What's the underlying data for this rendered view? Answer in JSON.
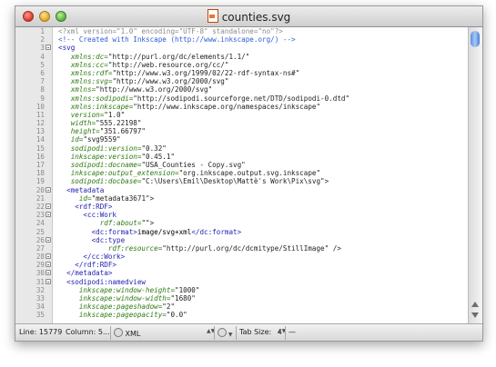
{
  "window": {
    "title": "counties.svg",
    "file_icon": "svg-file-icon"
  },
  "editor": {
    "lines": [
      {
        "n": "1",
        "fold": false,
        "segs": [
          {
            "t": "<?xml version=\"1.0\" encoding=\"UTF-8\" standalone=\"no\"?>",
            "c": "decl"
          }
        ]
      },
      {
        "n": "2",
        "fold": false,
        "segs": [
          {
            "t": "<!-- Created with Inkscape (http://www.inkscape.org/) -->",
            "c": "comment"
          }
        ]
      },
      {
        "n": "3",
        "fold": true,
        "segs": [
          {
            "t": "<svg",
            "c": "tag"
          }
        ]
      },
      {
        "n": "4",
        "fold": false,
        "segs": [
          {
            "t": "   xmlns:dc=",
            "c": "attr"
          },
          {
            "t": "\"http://purl.org/dc/elements/1.1/\"",
            "c": "val"
          }
        ]
      },
      {
        "n": "5",
        "fold": false,
        "segs": [
          {
            "t": "   xmlns:cc=",
            "c": "attr"
          },
          {
            "t": "\"http://web.resource.org/cc/\"",
            "c": "val"
          }
        ]
      },
      {
        "n": "6",
        "fold": false,
        "segs": [
          {
            "t": "   xmlns:rdf=",
            "c": "attr"
          },
          {
            "t": "\"http://www.w3.org/1999/02/22-rdf-syntax-ns#\"",
            "c": "val"
          }
        ]
      },
      {
        "n": "7",
        "fold": false,
        "segs": [
          {
            "t": "   xmlns:svg=",
            "c": "attr"
          },
          {
            "t": "\"http://www.w3.org/2000/svg\"",
            "c": "val"
          }
        ]
      },
      {
        "n": "8",
        "fold": false,
        "segs": [
          {
            "t": "   xmlns=",
            "c": "attr"
          },
          {
            "t": "\"http://www.w3.org/2000/svg\"",
            "c": "val"
          }
        ]
      },
      {
        "n": "9",
        "fold": false,
        "segs": [
          {
            "t": "   xmlns:sodipodi=",
            "c": "attr"
          },
          {
            "t": "\"http://sodipodi.sourceforge.net/DTD/sodipodi-0.dtd\"",
            "c": "val"
          }
        ]
      },
      {
        "n": "10",
        "fold": false,
        "segs": [
          {
            "t": "   xmlns:inkscape=",
            "c": "attr"
          },
          {
            "t": "\"http://www.inkscape.org/namespaces/inkscape\"",
            "c": "val"
          }
        ]
      },
      {
        "n": "11",
        "fold": false,
        "segs": [
          {
            "t": "   version=",
            "c": "attr"
          },
          {
            "t": "\"1.0\"",
            "c": "val"
          }
        ]
      },
      {
        "n": "12",
        "fold": false,
        "segs": [
          {
            "t": "   width=",
            "c": "attr"
          },
          {
            "t": "\"555.22198\"",
            "c": "val"
          }
        ]
      },
      {
        "n": "13",
        "fold": false,
        "segs": [
          {
            "t": "   height=",
            "c": "attr"
          },
          {
            "t": "\"351.66797\"",
            "c": "val"
          }
        ]
      },
      {
        "n": "14",
        "fold": false,
        "segs": [
          {
            "t": "   id=",
            "c": "attr"
          },
          {
            "t": "\"svg9559\"",
            "c": "val"
          }
        ]
      },
      {
        "n": "15",
        "fold": false,
        "segs": [
          {
            "t": "   sodipodi:version=",
            "c": "attr"
          },
          {
            "t": "\"0.32\"",
            "c": "val"
          }
        ]
      },
      {
        "n": "16",
        "fold": false,
        "segs": [
          {
            "t": "   inkscape:version=",
            "c": "attr"
          },
          {
            "t": "\"0.45.1\"",
            "c": "val"
          }
        ]
      },
      {
        "n": "17",
        "fold": false,
        "segs": [
          {
            "t": "   sodipodi:docname=",
            "c": "attr"
          },
          {
            "t": "\"USA_Counties - Copy.svg\"",
            "c": "val"
          }
        ]
      },
      {
        "n": "18",
        "fold": false,
        "segs": [
          {
            "t": "   inkscape:output_extension=",
            "c": "attr"
          },
          {
            "t": "\"org.inkscape.output.svg.inkscape\"",
            "c": "val"
          }
        ]
      },
      {
        "n": "19",
        "fold": false,
        "segs": [
          {
            "t": "   sodipodi:docbase=",
            "c": "attr"
          },
          {
            "t": "\"C:\\Users\\Emil\\Desktop\\Mattè's Work\\Pix\\svg\">",
            "c": "val"
          }
        ]
      },
      {
        "n": "20",
        "fold": true,
        "segs": [
          {
            "t": "  <metadata",
            "c": "tag"
          }
        ]
      },
      {
        "n": "21",
        "fold": false,
        "segs": [
          {
            "t": "     id=",
            "c": "attr"
          },
          {
            "t": "\"metadata3671\">",
            "c": "val"
          }
        ]
      },
      {
        "n": "22",
        "fold": true,
        "segs": [
          {
            "t": "    <rdf:RDF>",
            "c": "tag"
          }
        ]
      },
      {
        "n": "23",
        "fold": true,
        "segs": [
          {
            "t": "      <cc:Work",
            "c": "tag"
          }
        ]
      },
      {
        "n": "24",
        "fold": false,
        "segs": [
          {
            "t": "          rdf:about=",
            "c": "attr"
          },
          {
            "t": "\"\">",
            "c": "val"
          }
        ]
      },
      {
        "n": "25",
        "fold": false,
        "segs": [
          {
            "t": "        <dc:format>",
            "c": "tag"
          },
          {
            "t": "image/svg+xml",
            "c": "text"
          },
          {
            "t": "</dc:format>",
            "c": "tag"
          }
        ]
      },
      {
        "n": "26",
        "fold": true,
        "segs": [
          {
            "t": "        <dc:type",
            "c": "tag"
          }
        ]
      },
      {
        "n": "27",
        "fold": false,
        "segs": [
          {
            "t": "            rdf:resource=",
            "c": "attr"
          },
          {
            "t": "\"http://purl.org/dc/dcmitype/StillImage\" />",
            "c": "val"
          }
        ]
      },
      {
        "n": "28",
        "fold": true,
        "segs": [
          {
            "t": "      </cc:Work>",
            "c": "tag"
          }
        ]
      },
      {
        "n": "29",
        "fold": true,
        "segs": [
          {
            "t": "    </rdf:RDF>",
            "c": "tag"
          }
        ]
      },
      {
        "n": "30",
        "fold": true,
        "segs": [
          {
            "t": "  </metadata>",
            "c": "tag"
          }
        ]
      },
      {
        "n": "31",
        "fold": true,
        "segs": [
          {
            "t": "  <sodipodi:namedview",
            "c": "tag"
          }
        ]
      },
      {
        "n": "32",
        "fold": false,
        "segs": [
          {
            "t": "     inkscape:window-height=",
            "c": "attr"
          },
          {
            "t": "\"1000\"",
            "c": "val"
          }
        ]
      },
      {
        "n": "33",
        "fold": false,
        "segs": [
          {
            "t": "     inkscape:window-width=",
            "c": "attr"
          },
          {
            "t": "\"1680\"",
            "c": "val"
          }
        ]
      },
      {
        "n": "34",
        "fold": false,
        "segs": [
          {
            "t": "     inkscape:pageshadow=",
            "c": "attr"
          },
          {
            "t": "\"2\"",
            "c": "val"
          }
        ]
      },
      {
        "n": "35",
        "fold": false,
        "segs": [
          {
            "t": "     inkscape:pageopacity=",
            "c": "attr"
          },
          {
            "t": "\"0.0\"",
            "c": "val"
          }
        ]
      }
    ]
  },
  "statusbar": {
    "line": "Line: 15779",
    "column": "Column: 5...",
    "language": "XML",
    "tab_size_label": "Tab Size:",
    "tab_size_value": "4",
    "symbol": "—"
  }
}
